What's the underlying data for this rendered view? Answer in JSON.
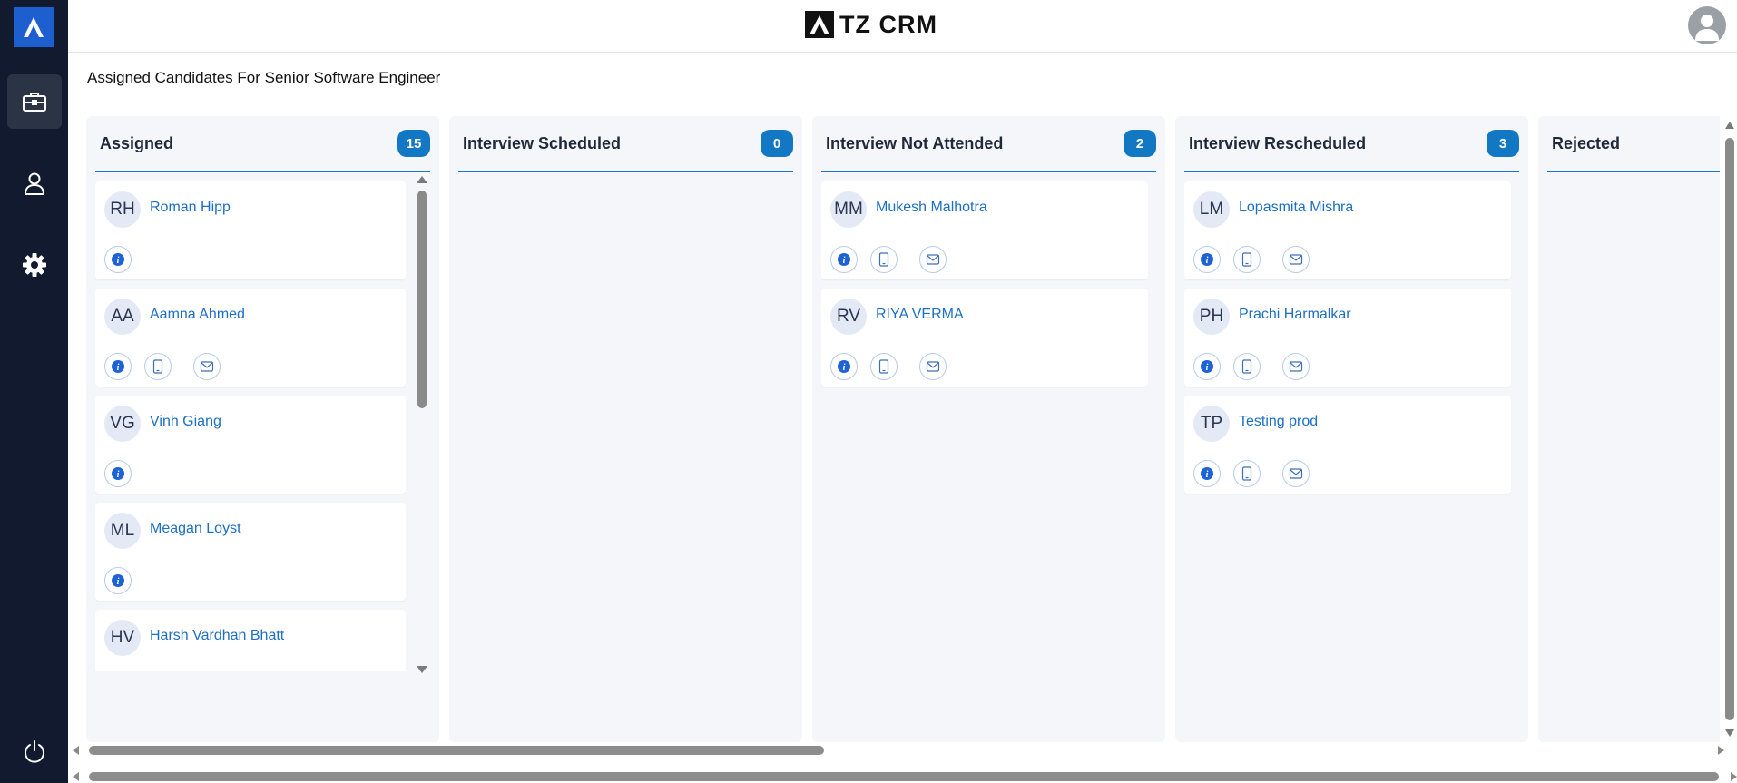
{
  "app": {
    "brand": "TZ CRM"
  },
  "sidebar": {
    "items": [
      {
        "name": "jobs",
        "icon": "briefcase-icon",
        "active": true
      },
      {
        "name": "users",
        "icon": "user-icon",
        "active": false
      },
      {
        "name": "settings",
        "icon": "gear-icon",
        "active": false
      },
      {
        "name": "logout",
        "icon": "power-icon",
        "active": false
      }
    ]
  },
  "page": {
    "title": "Assigned Candidates For Senior Software Engineer"
  },
  "colors": {
    "sidebar_bg": "#111a2e",
    "accent": "#1278c4",
    "link": "#1c6fc2",
    "column_bg": "#f4f6fa"
  },
  "columns": [
    {
      "title": "Assigned",
      "count": "15",
      "cards": [
        {
          "initials": "RH",
          "name": "Roman Hipp",
          "actions": [
            "info-icon"
          ]
        },
        {
          "initials": "AA",
          "name": "Aamna Ahmed",
          "actions": [
            "info-icon",
            "phone-icon",
            "mail-icon"
          ]
        },
        {
          "initials": "VG",
          "name": "Vinh Giang",
          "actions": [
            "info-icon"
          ]
        },
        {
          "initials": "ML",
          "name": "Meagan Loyst",
          "actions": [
            "info-icon"
          ]
        },
        {
          "initials": "HV",
          "name": "Harsh Vardhan Bhatt",
          "actions": [
            "info-icon",
            "phone-icon",
            "mail-icon"
          ]
        }
      ]
    },
    {
      "title": "Interview Scheduled",
      "count": "0",
      "cards": []
    },
    {
      "title": "Interview Not Attended",
      "count": "2",
      "cards": [
        {
          "initials": "MM",
          "name": "Mukesh Malhotra",
          "actions": [
            "info-icon",
            "phone-icon",
            "mail-icon"
          ]
        },
        {
          "initials": "RV",
          "name": "RIYA VERMA",
          "actions": [
            "info-icon",
            "phone-icon",
            "mail-icon"
          ]
        }
      ]
    },
    {
      "title": "Interview Rescheduled",
      "count": "3",
      "cards": [
        {
          "initials": "LM",
          "name": "Lopasmita Mishra",
          "actions": [
            "info-icon",
            "phone-icon",
            "mail-icon"
          ]
        },
        {
          "initials": "PH",
          "name": "Prachi Harmalkar",
          "actions": [
            "info-icon",
            "phone-icon",
            "mail-icon"
          ]
        },
        {
          "initials": "TP",
          "name": "Testing prod",
          "actions": [
            "info-icon",
            "phone-icon",
            "mail-icon"
          ]
        }
      ]
    },
    {
      "title": "Rejected",
      "count": "",
      "cards": []
    }
  ]
}
